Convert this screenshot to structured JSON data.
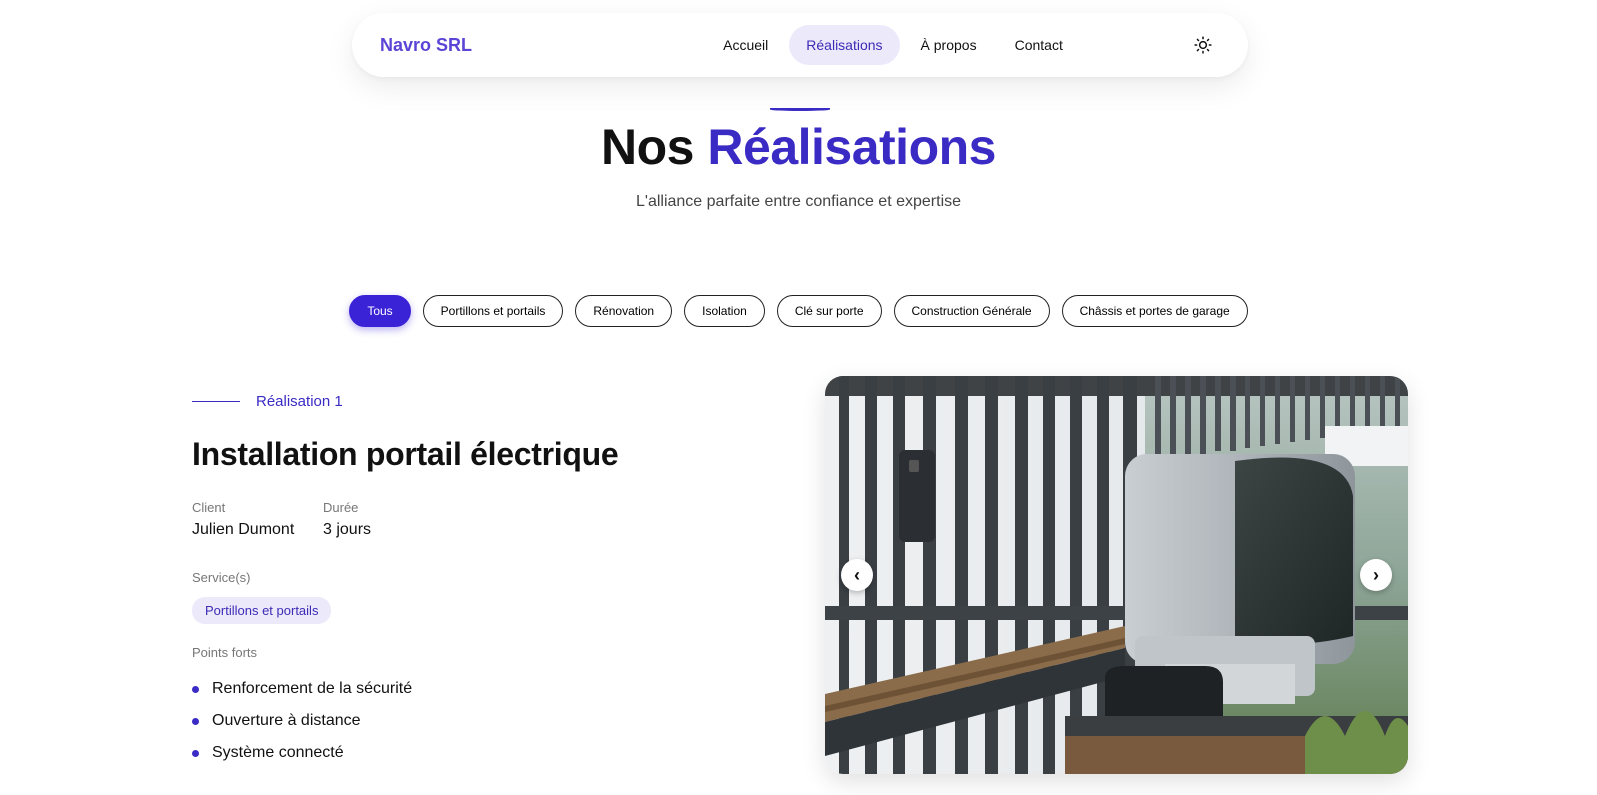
{
  "nav": {
    "brand": "Navro SRL",
    "links": [
      "Accueil",
      "Réalisations",
      "À propos",
      "Contact"
    ],
    "active": "Réalisations",
    "theme_icon": "sun-icon"
  },
  "hero": {
    "title_plain": "Nos",
    "title_accent": "Réalisations",
    "subtitle": "L'alliance parfaite entre confiance et expertise"
  },
  "filters": [
    "Tous",
    "Portillons et portails",
    "Rénovation",
    "Isolation",
    "Clé sur porte",
    "Construction Générale",
    "Châssis et portes de garage"
  ],
  "project": {
    "label": "Réalisation 1",
    "title": "Installation portail électrique",
    "client_label": "Client",
    "client": "Julien Dumont",
    "duration_label": "Durée",
    "duration": "3 jours",
    "services_label": "Service(s)",
    "service": "Portillons et portails",
    "points_label": "Points forts",
    "points": [
      "Renforcement de la sécurité",
      "Ouverture à distance",
      "Système connecté"
    ]
  },
  "carousel": {
    "prev_icon": "chevron-left-icon",
    "next_icon": "chevron-right-icon",
    "prev": "‹",
    "next": "›"
  },
  "colors": {
    "accent": "#3a2bc4",
    "chip_active": "#3a22d6",
    "nav_active_bg": "#ece9fb"
  }
}
